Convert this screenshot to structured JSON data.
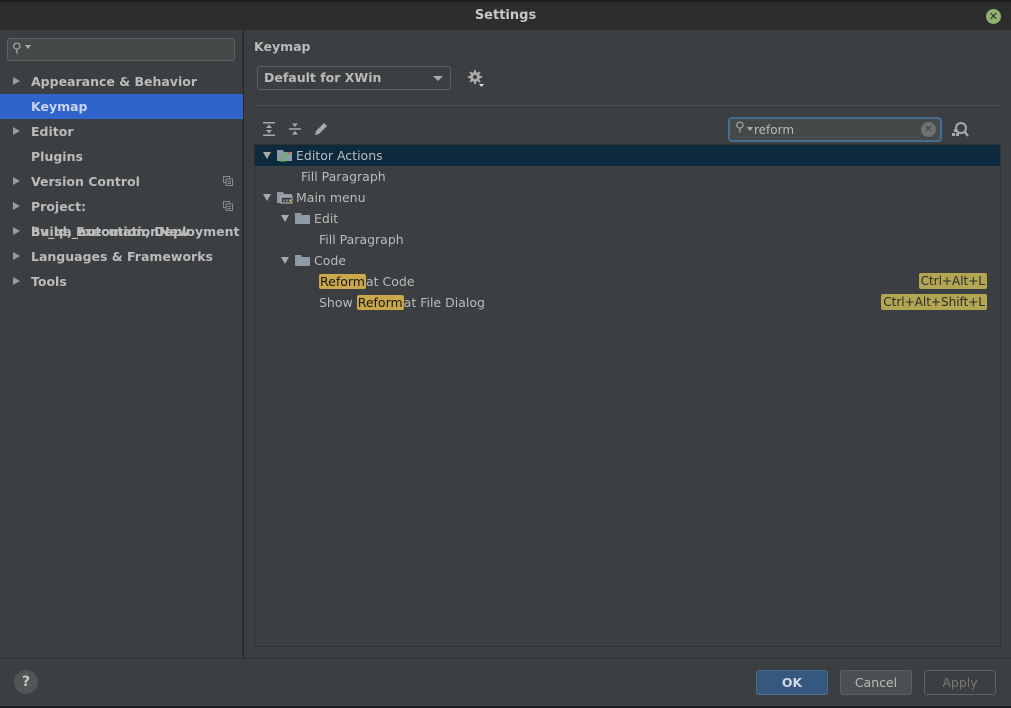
{
  "window": {
    "title": "Settings",
    "close_icon": "close-icon"
  },
  "sidebar": {
    "search": {
      "value": "",
      "placeholder": ""
    },
    "items": [
      {
        "label": "Appearance & Behavior",
        "expandable": true,
        "selected": false
      },
      {
        "label": "Keymap",
        "expandable": false,
        "selected": true
      },
      {
        "label": "Editor",
        "expandable": true,
        "selected": false
      },
      {
        "label": "Plugins",
        "expandable": false,
        "selected": false
      },
      {
        "label": "Version Control",
        "expandable": true,
        "selected": false,
        "project_icon": true
      },
      {
        "label": "Project: bv_qa_automationNew",
        "expandable": true,
        "selected": false,
        "project_icon": true
      },
      {
        "label": "Build, Execution, Deployment",
        "expandable": true,
        "selected": false
      },
      {
        "label": "Languages & Frameworks",
        "expandable": true,
        "selected": false
      },
      {
        "label": "Tools",
        "expandable": true,
        "selected": false
      }
    ]
  },
  "main": {
    "heading": "Keymap",
    "keymap_select": {
      "value": "Default for XWin"
    },
    "toolbar": {
      "expand_all": "expand-all-icon",
      "collapse_all": "collapse-all-icon",
      "edit": "edit-icon"
    },
    "filter": {
      "value": "reform"
    },
    "tree": [
      {
        "label_parts": [
          [
            "Editor Actions",
            false
          ]
        ],
        "level": 0,
        "expanded": true,
        "icon": "editor-actions-folder",
        "selected": true,
        "shortcut": ""
      },
      {
        "label_parts": [
          [
            "Fill Paragraph",
            false
          ]
        ],
        "level": 1,
        "leaf": true,
        "selected": false,
        "shortcut": ""
      },
      {
        "label_parts": [
          [
            "Main menu",
            false
          ]
        ],
        "level": 0,
        "expanded": true,
        "icon": "main-menu-folder",
        "selected": false,
        "shortcut": ""
      },
      {
        "label_parts": [
          [
            "Edit",
            false
          ]
        ],
        "level": 1,
        "expanded": true,
        "icon": "folder",
        "selected": false,
        "shortcut": ""
      },
      {
        "label_parts": [
          [
            "Fill Paragraph",
            false
          ]
        ],
        "level": 2,
        "leaf": true,
        "selected": false,
        "shortcut": ""
      },
      {
        "label_parts": [
          [
            "Code",
            false
          ]
        ],
        "level": 1,
        "expanded": true,
        "icon": "folder",
        "selected": false,
        "shortcut": ""
      },
      {
        "label_parts": [
          [
            "Reform",
            true
          ],
          [
            "at Code",
            false
          ]
        ],
        "level": 2,
        "leaf": true,
        "selected": false,
        "shortcut": "Ctrl+Alt+L"
      },
      {
        "label_parts": [
          [
            "Show ",
            false
          ],
          [
            "Reform",
            true
          ],
          [
            "at File Dialog",
            false
          ]
        ],
        "level": 2,
        "leaf": true,
        "selected": false,
        "shortcut": "Ctrl+Alt+Shift+L"
      }
    ]
  },
  "footer": {
    "help_label": "?",
    "ok_label": "OK",
    "cancel_label": "Cancel",
    "apply_label": "Apply"
  },
  "colors": {
    "selection": "#2f65ca",
    "tree_selection": "#0d293e",
    "highlight": "#c9a74a",
    "shortcut_bg": "#b3a652",
    "ok_button": "#365880",
    "close_button": "#8db36f"
  }
}
